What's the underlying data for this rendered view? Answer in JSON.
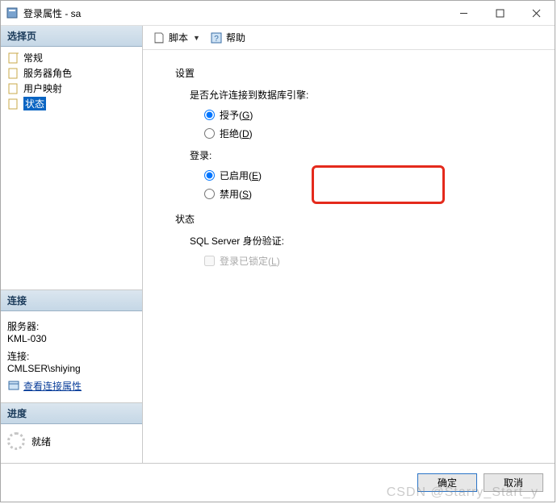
{
  "window": {
    "title": "登录属性 - sa"
  },
  "left": {
    "select_header": "选择页",
    "nav": [
      {
        "label": "常规"
      },
      {
        "label": "服务器角色"
      },
      {
        "label": "用户映射"
      },
      {
        "label": "状态",
        "selected": true
      }
    ],
    "conn_header": "连接",
    "server_label": "服务器:",
    "server_value": "KML-030",
    "conn_label": "连接:",
    "conn_value": "CMLSER\\shiying",
    "view_conn_props": "查看连接属性",
    "progress_header": "进度",
    "progress_text": "就绪"
  },
  "toolbar": {
    "script_label": "脚本",
    "help_label": "帮助"
  },
  "content": {
    "settings": "设置",
    "allow_connect": "是否允许连接到数据库引擎:",
    "grant_label": "授予(G)",
    "deny_label": "拒绝(D)",
    "login": "登录:",
    "enabled_label": "已启用(E)",
    "disabled_label": "禁用(S)",
    "status": "状态",
    "auth_label": "SQL Server 身份验证:",
    "locked_label": "登录已锁定(L)"
  },
  "footer": {
    "ok": "确定",
    "cancel": "取消"
  },
  "watermark": "CSDN @Starry_Start_y"
}
